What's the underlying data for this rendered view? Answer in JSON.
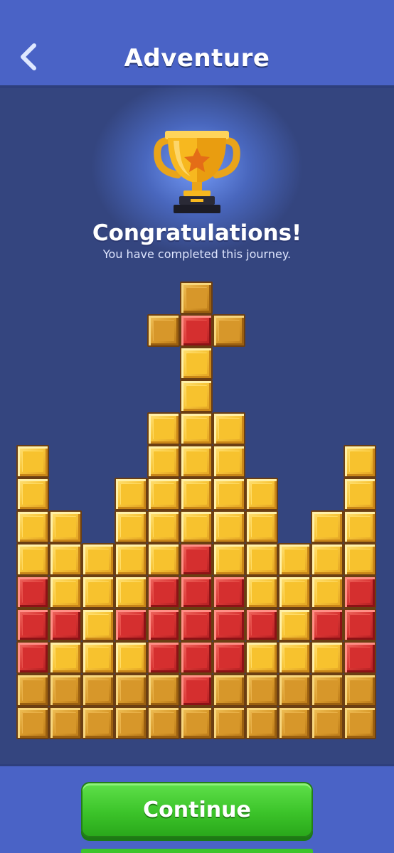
{
  "header": {
    "title": "Adventure",
    "back_icon": "chevron-left-icon"
  },
  "trophy": {
    "icon": "trophy-star-icon",
    "cup_color": "#f7b81f",
    "star_color": "#e46d17"
  },
  "message": {
    "title": "Congratulations!",
    "subtitle": "You have completed this journey."
  },
  "board": {
    "columns": 11,
    "rows": 14,
    "palette": {
      "G": "gold",
      "R": "red",
      "B": "bronze"
    },
    "grid": [
      ".....B.....",
      "....BRB....",
      ".....G.....",
      ".....G.....",
      "....GGG....",
      "G...GGG...G",
      "G..GGGGG..G",
      "GG.GGGGG.GG",
      "GGGGGRGGGGG",
      "RGGGRRRGGGR",
      "RRGRRRRRGRR",
      "RGGGRRRGGGR",
      "BBBBBRBBBBB",
      "BBBBBBBBBBB"
    ]
  },
  "actions": {
    "continue_label": "Continue"
  },
  "colors": {
    "background": "#34457f",
    "bar": "#4a63c6",
    "button": "#3cc42a",
    "gold": "#f8c63a",
    "red": "#d93634",
    "bronze": "#d99a2b"
  }
}
